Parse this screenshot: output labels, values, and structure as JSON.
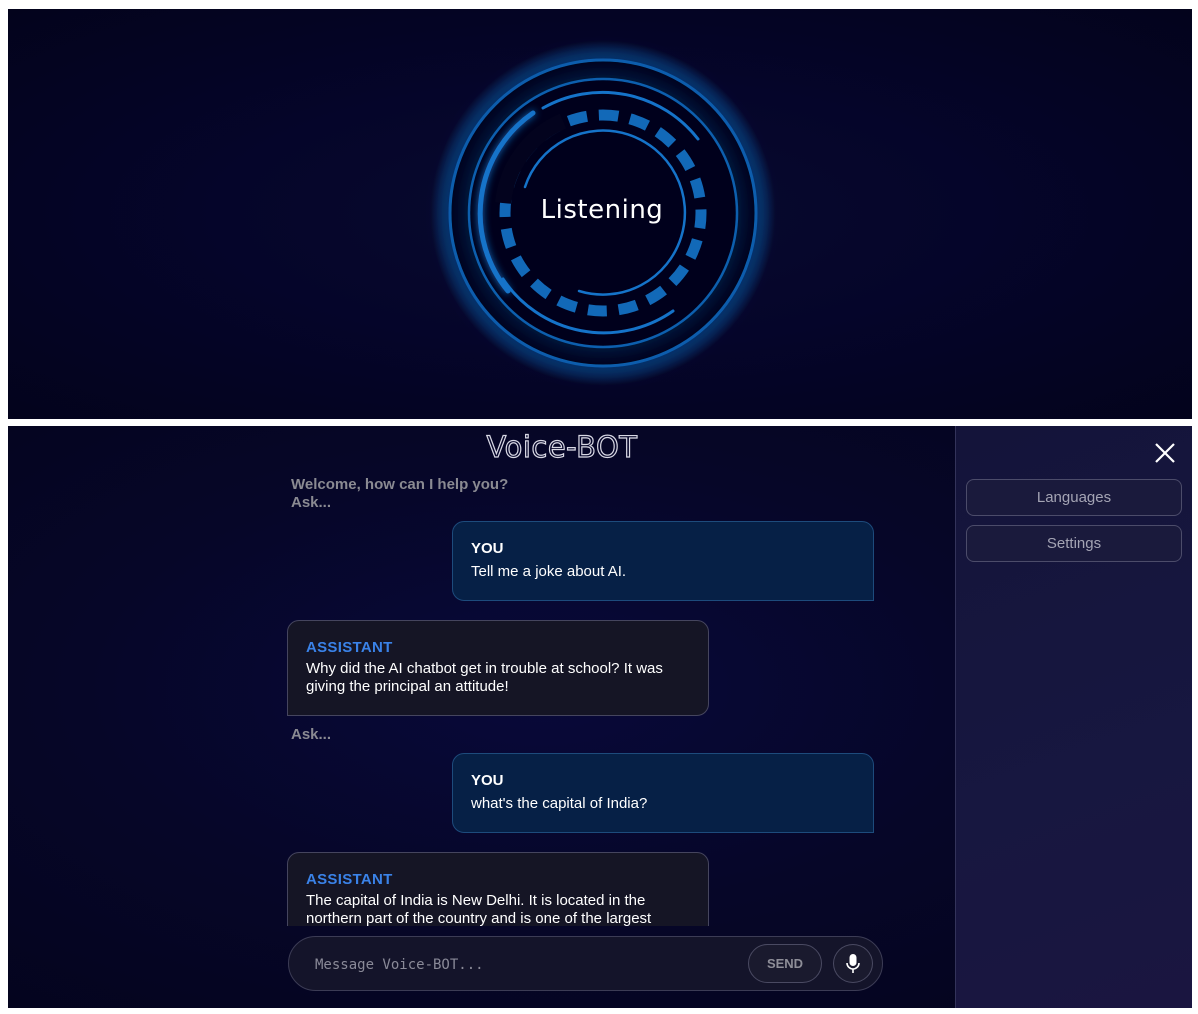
{
  "listening_view": {
    "status_label": "Listening"
  },
  "chat_view": {
    "app_title": "Voice-BOT",
    "welcome": "Welcome, how can I help you?",
    "ask_label": "Ask...",
    "messages": [
      {
        "role": "YOU",
        "text": "Tell me a joke about AI."
      },
      {
        "role": "ASSISTANT",
        "text": "Why did the AI chatbot get in trouble at school? It was giving the principal an attitude!"
      },
      {
        "role": "YOU",
        "text": "what's the capital of India?"
      },
      {
        "role": "ASSISTANT",
        "text": "The capital of India is New Delhi. It is located in the northern part of the country and is one of the largest"
      }
    ],
    "input": {
      "placeholder": "Message Voice-BOT...",
      "value": ""
    },
    "send_label": "SEND",
    "mic_icon": "microphone-icon"
  },
  "sidebar": {
    "close_icon": "close-icon",
    "items": [
      {
        "label": "Languages"
      },
      {
        "label": "Settings"
      }
    ]
  },
  "colors": {
    "accent_blue": "#1e9bff",
    "assistant_role": "#3a82e8",
    "user_bubble": "#062046",
    "assistant_bubble": "#151525",
    "background": "#05052a"
  }
}
